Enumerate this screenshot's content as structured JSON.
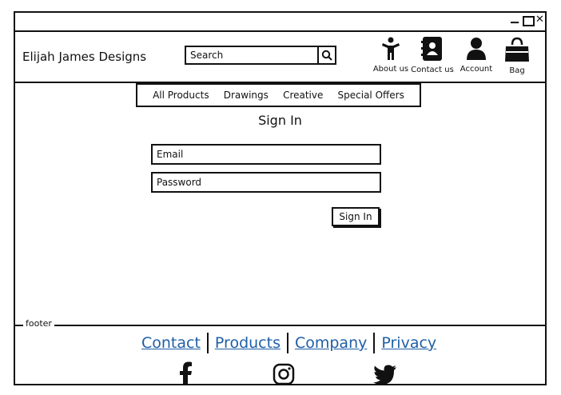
{
  "window": {
    "controls": [
      "minimize",
      "maximize",
      "close"
    ]
  },
  "header": {
    "brand": "Elijah James Designs",
    "search": {
      "placeholder": "Search"
    },
    "icons": [
      {
        "label": "About us",
        "icon": "person-icon"
      },
      {
        "label": "Contact us",
        "icon": "contact-book-icon"
      },
      {
        "label": "Account",
        "icon": "user-icon"
      },
      {
        "label": "Bag",
        "icon": "shopping-bag-icon"
      }
    ]
  },
  "nav": {
    "items": [
      "All Products",
      "Drawings",
      "Creative",
      "Special Offers"
    ]
  },
  "main": {
    "title": "Sign In",
    "email_placeholder": "Email",
    "password_placeholder": "Password",
    "signin_label": "Sign In"
  },
  "footer": {
    "label": "footer",
    "links": [
      "Contact",
      "Products",
      "Company",
      "Privacy"
    ],
    "link_color": "#1f5fa6",
    "social": [
      "facebook-icon",
      "instagram-icon",
      "twitter-icon"
    ]
  }
}
